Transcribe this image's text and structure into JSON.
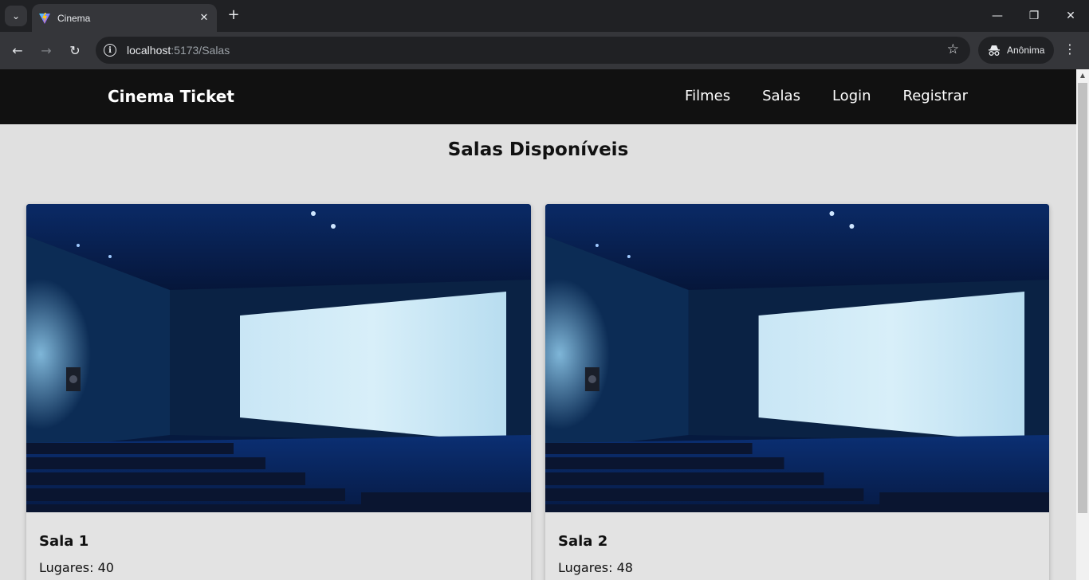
{
  "browser": {
    "tab_title": "Cinema",
    "url_host": "localhost",
    "url_path": ":5173/Salas",
    "profile_label": "Anônima"
  },
  "navbar": {
    "brand": "Cinema Ticket",
    "links": [
      "Filmes",
      "Salas",
      "Login",
      "Registrar"
    ]
  },
  "page": {
    "heading": "Salas Disponíveis"
  },
  "rooms": [
    {
      "name": "Sala 1",
      "seats_label": "Lugares: 40"
    },
    {
      "name": "Sala 2",
      "seats_label": "Lugares: 48"
    }
  ],
  "colors": {
    "navbar_bg": "#111111",
    "page_bg": "#e0e0e0",
    "card_bg": "#e3e3e3"
  }
}
